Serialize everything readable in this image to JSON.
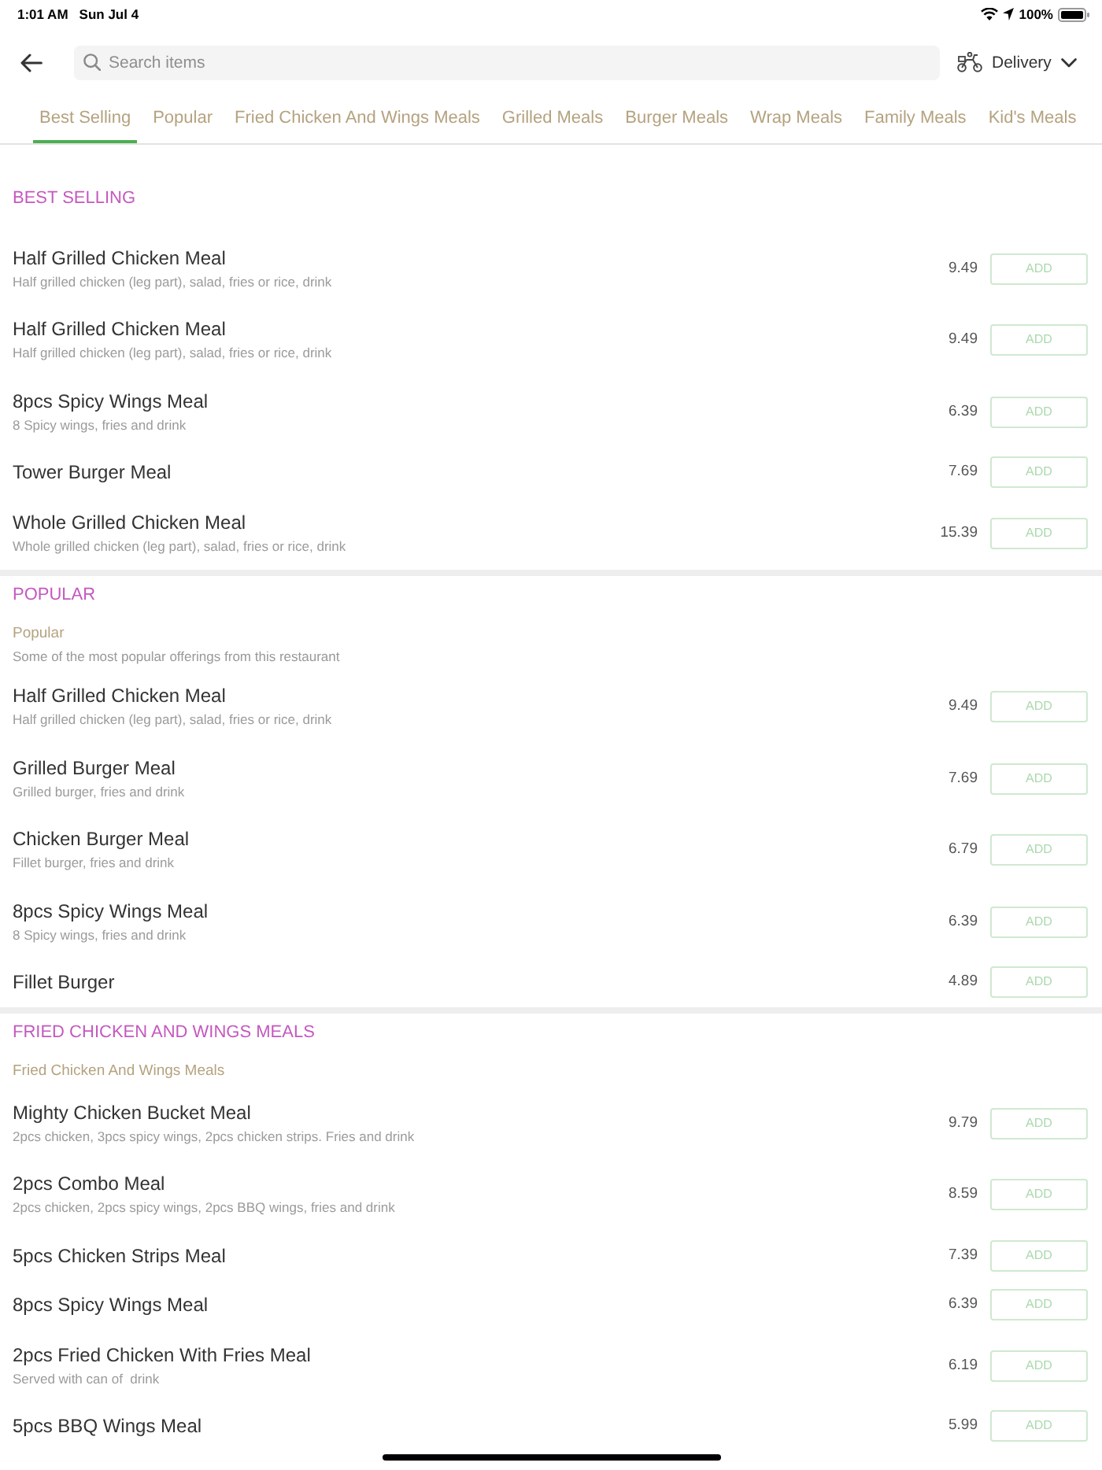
{
  "status_bar": {
    "time": "1:01 AM",
    "date": "Sun Jul 4",
    "battery": "100%"
  },
  "header": {
    "search": {
      "placeholder": "Search items"
    },
    "order_mode": "Delivery"
  },
  "tabs": [
    {
      "label": "Best Selling",
      "selected": true
    },
    {
      "label": "Popular",
      "selected": false
    },
    {
      "label": "Fried Chicken And Wings Meals",
      "selected": false
    },
    {
      "label": "Grilled Meals",
      "selected": false
    },
    {
      "label": "Burger Meals",
      "selected": false
    },
    {
      "label": "Wrap Meals",
      "selected": false
    },
    {
      "label": "Family Meals",
      "selected": false
    },
    {
      "label": "Kid's Meals",
      "selected": false
    }
  ],
  "sections": [
    {
      "title": "BEST SELLING",
      "items": [
        {
          "name": "Half Grilled Chicken Meal",
          "description": "Half grilled chicken (leg part), salad, fries or rice, drink",
          "price": "9.49",
          "button": "ADD"
        },
        {
          "name": "Half Grilled Chicken Meal",
          "description": "Half grilled chicken (leg part), salad, fries or rice, drink",
          "price": "9.49",
          "button": "ADD"
        },
        {
          "name": "8pcs Spicy Wings Meal",
          "description": "8 Spicy wings, fries and drink",
          "price": "6.39",
          "button": "ADD"
        },
        {
          "name": "Tower Burger Meal",
          "price": "7.69",
          "button": "ADD"
        },
        {
          "name": "Whole Grilled Chicken Meal",
          "description": "Whole grilled chicken (leg part), salad, fries or rice, drink",
          "price": "15.39",
          "button": "ADD"
        }
      ]
    },
    {
      "title": "POPULAR",
      "category": {
        "title": "Popular",
        "description": "Some of the most popular offerings from this restaurant"
      },
      "items": [
        {
          "name": "Half Grilled Chicken Meal",
          "description": "Half grilled chicken (leg part), salad, fries or rice, drink",
          "price": "9.49",
          "button": "ADD"
        },
        {
          "name": "Grilled Burger Meal",
          "description": "Grilled burger, fries and drink",
          "price": "7.69",
          "button": "ADD"
        },
        {
          "name": "Chicken Burger Meal",
          "description": "Fillet burger, fries and drink",
          "price": "6.79",
          "button": "ADD"
        },
        {
          "name": "8pcs Spicy Wings Meal",
          "description": "8 Spicy wings, fries and drink",
          "price": "6.39",
          "button": "ADD"
        },
        {
          "name": "Fillet Burger",
          "price": "4.89",
          "button": "ADD"
        }
      ]
    },
    {
      "title": "FRIED CHICKEN AND WINGS MEALS",
      "category": {
        "title": "Fried Chicken And Wings Meals"
      },
      "items": [
        {
          "name": "Mighty Chicken Bucket Meal",
          "description": "2pcs chicken, 3pcs spicy wings, 2pcs chicken strips. Fries and drink",
          "price": "9.79",
          "button": "ADD"
        },
        {
          "name": "2pcs Combo Meal",
          "description": "2pcs chicken, 2pcs spicy wings, 2pcs BBQ wings, fries and drink",
          "price": "8.59",
          "button": "ADD"
        },
        {
          "name": "5pcs Chicken Strips Meal",
          "price": "7.39",
          "button": "ADD"
        },
        {
          "name": "8pcs Spicy Wings Meal",
          "price": "6.39",
          "button": "ADD"
        },
        {
          "name": "2pcs Fried Chicken With Fries Meal",
          "description": "Served with can of  drink",
          "price": "6.19",
          "button": "ADD"
        },
        {
          "name": "5pcs BBQ Wings Meal",
          "price": "5.99",
          "button": "ADD"
        }
      ]
    }
  ]
}
